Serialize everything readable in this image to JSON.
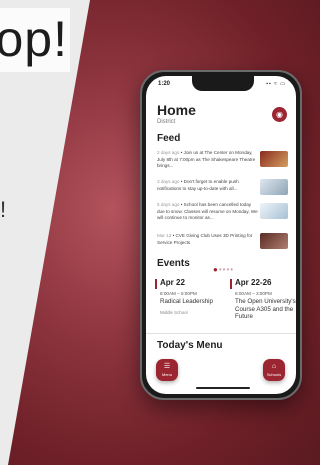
{
  "banner": {
    "text": "op!",
    "side_mark": "!"
  },
  "status": {
    "time": "1:20",
    "icons": "▪▪ ≈ ▭"
  },
  "header": {
    "title": "Home",
    "subtitle": "District",
    "profile_icon": "profile-icon"
  },
  "feed": {
    "title": "Feed",
    "items": [
      {
        "date": "2 days ago",
        "text": "Join us at The Center on Monday, July 8th at 7:00pm as The Shakespeare Theatre brings...",
        "thumb_color": "#8a2a1e"
      },
      {
        "date": "3 days ago",
        "text": "Don't forget to enable push notifications to stay up-to-date with all...",
        "thumb_color": "#b9c9d6"
      },
      {
        "date": "5 days ago",
        "text": "School has been cancelled today due to snow. Classes will resume on Monday. We will continue to monitor as...",
        "thumb_color": "#c6d8e6"
      },
      {
        "date": "Mar 13",
        "text": "CVE Giving Club Uses 3D Printing for Service Projects",
        "thumb_color": "#7a3a36"
      }
    ]
  },
  "events": {
    "title": "Events",
    "cards": [
      {
        "date": "Apr 22",
        "time": "8:00AM – 5:00PM",
        "title": "Radical Leadership",
        "location": "Middle School"
      },
      {
        "date": "Apr 22-26",
        "time": "8:00AM – 3:00PM",
        "title": "The Open University's Course A305 and the Future"
      }
    ]
  },
  "menu": {
    "title": "Today's Menu"
  },
  "nav": {
    "menu_label": "Menu",
    "schools_label": "Schools"
  },
  "colors": {
    "accent": "#9b2530",
    "background": "#7a2630"
  }
}
